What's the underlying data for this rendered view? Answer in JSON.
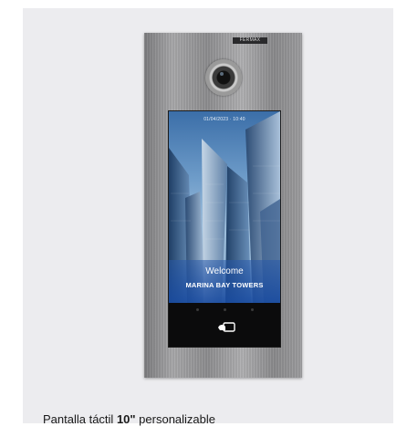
{
  "panel": {
    "brand": "FERMAX",
    "screen": {
      "status_text": "01/04/2023 · 10:40",
      "welcome": "Welcome",
      "building": "MARINA BAY TOWERS",
      "reader_icon": "card-reader-icon"
    }
  },
  "caption": {
    "prefix": "Pantalla táctil ",
    "bold": "10\"",
    "suffix": " personalizable"
  }
}
